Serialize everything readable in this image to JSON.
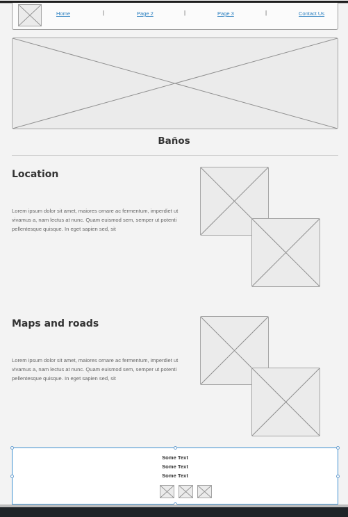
{
  "nav": {
    "links": [
      {
        "label": "Home"
      },
      {
        "label": "Page 2"
      },
      {
        "label": "Page 3"
      },
      {
        "label": "Contact Us"
      }
    ],
    "separator": "|"
  },
  "page": {
    "title": "Baños"
  },
  "sections": [
    {
      "title": "Location",
      "body": "Lorem ipsum dolor sit amet, maiores ornare ac fermentum, imperdiet ut vivamus a, nam lectus at nunc. Quam euismod sem, semper ut potenti pellentesque quisque. In eget sapien sed, sit"
    },
    {
      "title": "Maps and roads",
      "body": "Lorem ipsum dolor sit amet, maiores ornare ac fermentum, imperdiet ut vivamus a, nam lectus at nunc. Quam euismod sem, semper ut potenti pellentesque quisque. In eget sapien sed, sit"
    }
  ],
  "footer": {
    "lines": [
      "Some Text",
      "Some Text",
      "Some Text"
    ]
  },
  "colors": {
    "background": "#f3f3f3",
    "link": "#2a7fc0",
    "selection": "#3d8fcf",
    "placeholder": "#ebebeb"
  }
}
